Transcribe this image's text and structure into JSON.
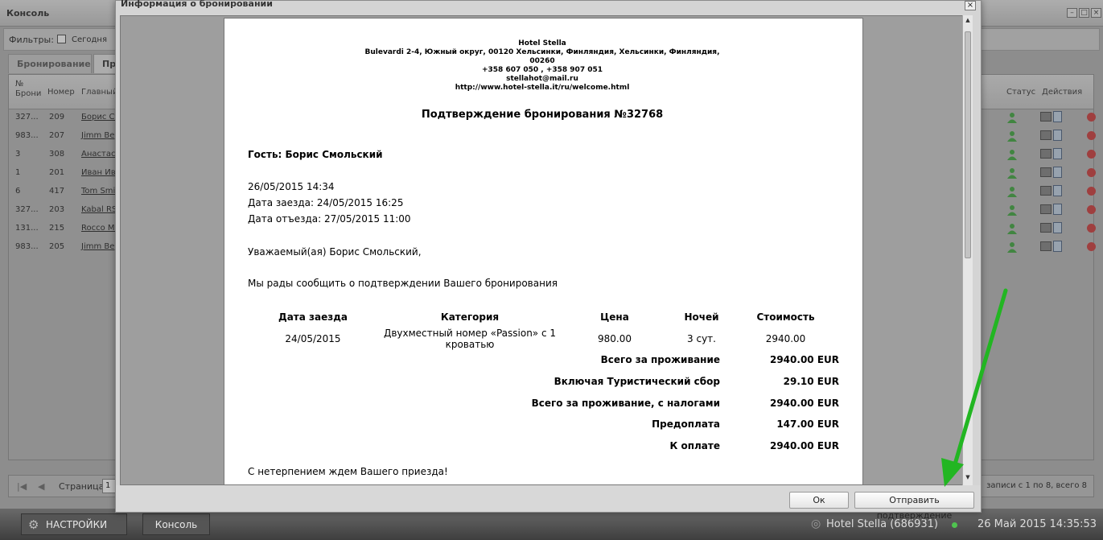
{
  "console": {
    "title": "Консоль",
    "filters_label": "Фильтры:",
    "filters_date": "Сегодня",
    "tabs": [
      "Бронирование",
      "Пр"
    ],
    "columns": {
      "booking_no": "№ Брони",
      "room": "Номер",
      "main_guest": "Главный",
      "status": "Статус",
      "actions": "Действия"
    },
    "rows": [
      {
        "booking": "327...",
        "room": "209",
        "guest": "Борис Ст"
      },
      {
        "booking": "983...",
        "room": "207",
        "guest": "Jimm Be"
      },
      {
        "booking": "3",
        "room": "308",
        "guest": "Анастас"
      },
      {
        "booking": "1",
        "room": "201",
        "guest": "Иван Ив"
      },
      {
        "booking": "6",
        "room": "417",
        "guest": "Tom Smi"
      },
      {
        "booking": "327...",
        "room": "203",
        "guest": "Kabal RS"
      },
      {
        "booking": "131...",
        "room": "215",
        "guest": "Rocco Mi"
      },
      {
        "booking": "983...",
        "room": "205",
        "guest": "Jimm Be"
      }
    ],
    "pager": {
      "page_label": "Страница",
      "page_value": "1",
      "records_info": "записи с 1 по 8, всего 8"
    }
  },
  "taskbar": {
    "settings_label": "НАСТРОЙКИ",
    "console_label": "Консоль",
    "hotel_status": "Hotel Stella (686931)",
    "datetime": "26 Май 2015 14:35:53"
  },
  "modal": {
    "title": "Информация о бронировании",
    "ok_label": "Ок",
    "send_label": "Отправить подтверждение"
  },
  "document": {
    "hotel_name": "Hotel Stella",
    "address_line1": "Bulevardi 2-4, Южный округ, 00120 Хельсинки, Финляндия, Хельсинки, Финляндия,",
    "address_line2": "00260",
    "phones": "+358 607 050 , +358 907 051",
    "email": "stellahot@mail.ru",
    "website": "http://www.hotel-stella.it/ru/welcome.html",
    "title": "Подтверждение бронирования №32768",
    "guest_line": "Гость: Борис Смольский",
    "created": "26/05/2015 14:34",
    "checkin_line": "Дата заезда: 24/05/2015 16:25",
    "checkout_line": "Дата отъезда: 27/05/2015 11:00",
    "greeting": "Уважаемый(ая) Борис Смольский,",
    "message": "Мы рады сообщить о подтверждении Вашего бронирования",
    "table": {
      "headers": {
        "checkin": "Дата заезда",
        "category": "Категория",
        "price": "Цена",
        "nights": "Ночей",
        "cost": "Стоимость"
      },
      "row": {
        "checkin": "24/05/2015",
        "category_line1": "Двухместный номер «Passion» с 1",
        "category_line2": "кроватью",
        "price": "980.00",
        "nights": "3 сут.",
        "cost": "2940.00"
      }
    },
    "totals": [
      {
        "label": "Всего за проживание",
        "value": "2940.00 EUR"
      },
      {
        "label": "Включая Туристический сбор",
        "value": "29.10 EUR"
      },
      {
        "label": "Всего за проживание, с налогами",
        "value": "2940.00 EUR"
      },
      {
        "label": "Предоплата",
        "value": "147.00 EUR"
      },
      {
        "label": "К оплате",
        "value": "2940.00 EUR"
      }
    ],
    "closing": "С нетерпением ждем Вашего приезда!"
  },
  "colors": {
    "annotation_arrow": "#22b622",
    "status_icon": "#4cae4c"
  }
}
